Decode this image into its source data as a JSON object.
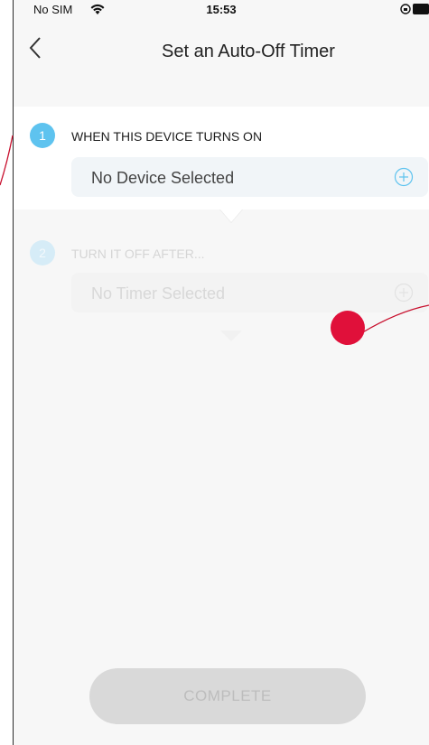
{
  "status_bar": {
    "carrier": "No SIM",
    "time": "15:53",
    "icons": [
      "wifi-icon",
      "orientation-lock-icon",
      "battery-icon"
    ]
  },
  "nav": {
    "title": "Set an Auto-Off Timer",
    "back_icon": "chevron-left-icon"
  },
  "steps": [
    {
      "number": "1",
      "title": "WHEN THIS DEVICE TURNS ON",
      "selector_value": "No Device Selected",
      "selector_icon": "plus-circle-icon",
      "enabled": true
    },
    {
      "number": "2",
      "title": "TURN IT OFF AFTER...",
      "selector_value": "No Timer Selected",
      "selector_icon": "plus-circle-icon",
      "enabled": false
    }
  ],
  "footer": {
    "complete_label": "COMPLETE",
    "enabled": false
  },
  "colors": {
    "accent": "#5ec3ef",
    "accent_disabled": "#d6ecf7",
    "background": "#f7f7f7",
    "card": "#ffffff",
    "button_disabled": "#d9d9d9",
    "touch_indicator": "#e0103a"
  }
}
